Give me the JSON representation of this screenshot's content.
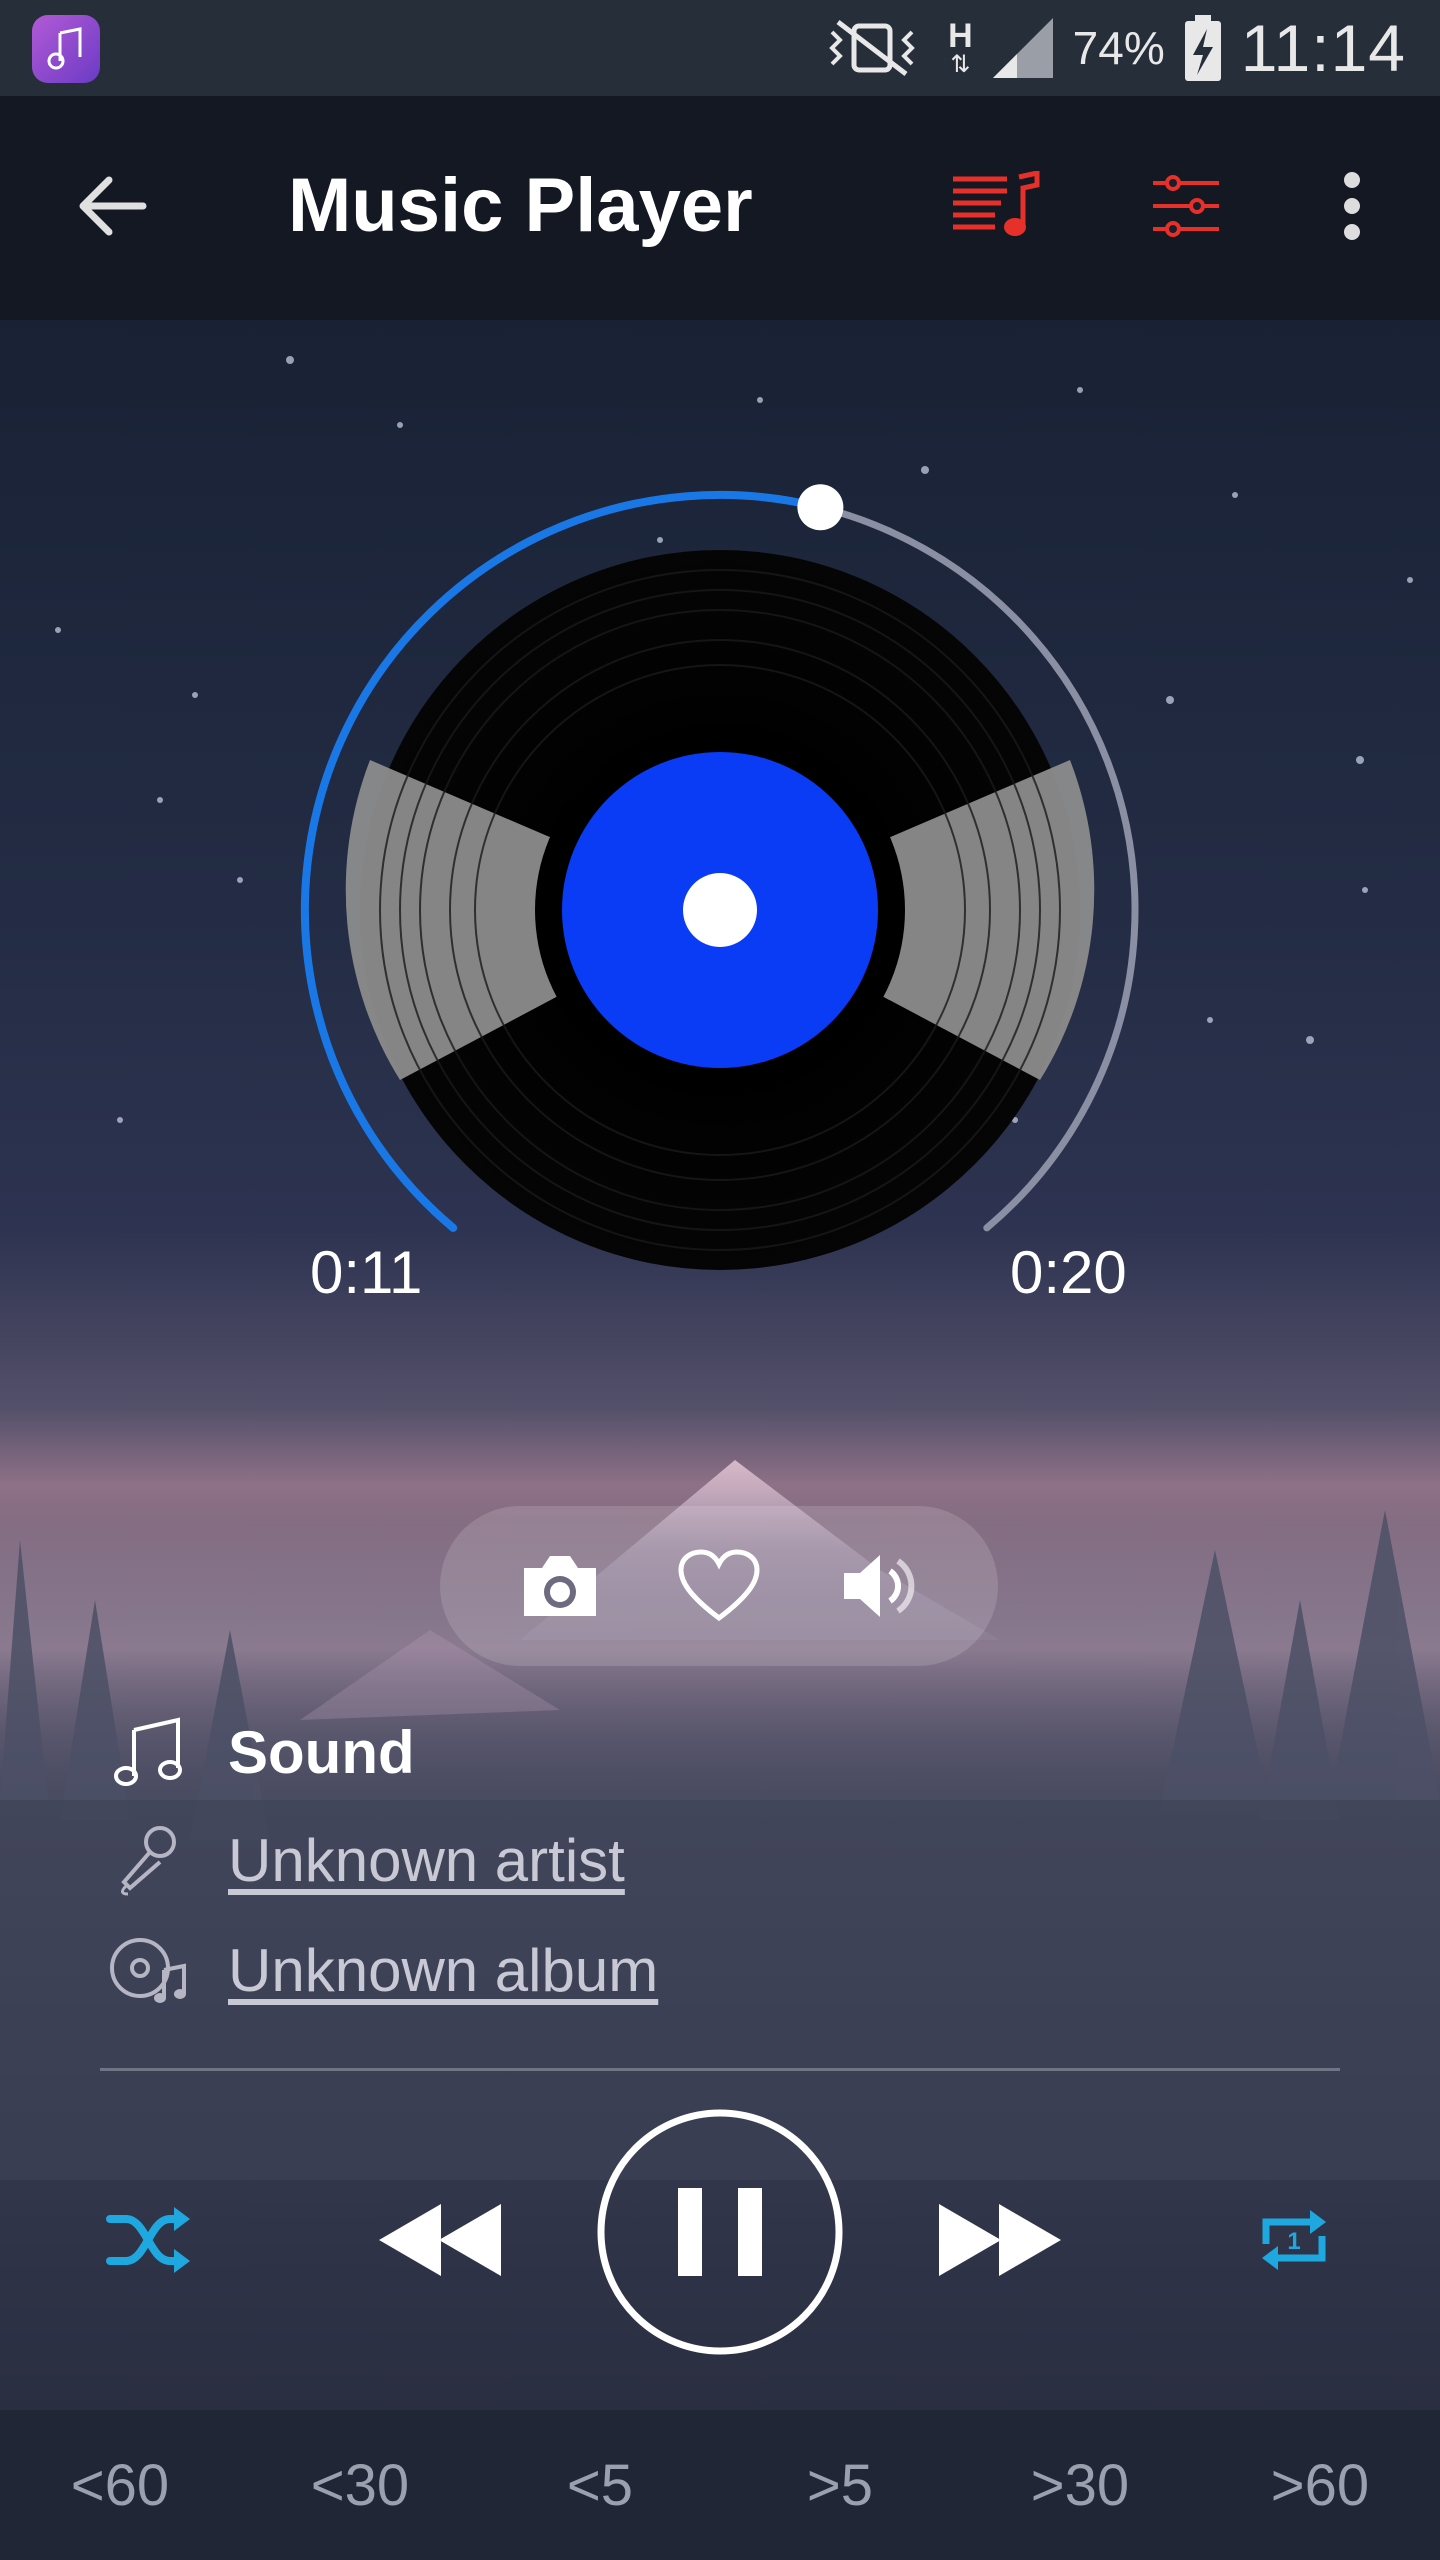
{
  "status_bar": {
    "battery_percent": "74%",
    "time": "11:14",
    "network_label": "H",
    "icons": [
      "app-music-icon",
      "vibrate-mute-icon",
      "signal-icon",
      "battery-charging-icon"
    ]
  },
  "toolbar": {
    "title": "Music Player",
    "icons": [
      "back-arrow-icon",
      "playlist-icon",
      "equalizer-icon",
      "more-vert-icon"
    ],
    "accent_color": "#e8302a"
  },
  "player": {
    "elapsed": "0:11",
    "duration": "0:20",
    "progress_fraction": 0.55,
    "disc_label_color": "#0a3cf5",
    "progress_color": "#1a78e6"
  },
  "actions": {
    "icons": [
      "camera-icon",
      "heart-icon",
      "volume-icon"
    ]
  },
  "track": {
    "title": "Sound",
    "artist": "Unknown artist",
    "album": "Unknown album"
  },
  "controls": {
    "icons": [
      "shuffle-icon",
      "rewind-icon",
      "pause-icon",
      "fast-forward-icon",
      "repeat-one-icon"
    ],
    "shuffle_color": "#1fa8e0",
    "repeat_color": "#1fa8e0"
  },
  "seek": {
    "items": [
      "<60",
      "<30",
      "<5",
      ">5",
      ">30",
      ">60"
    ]
  }
}
